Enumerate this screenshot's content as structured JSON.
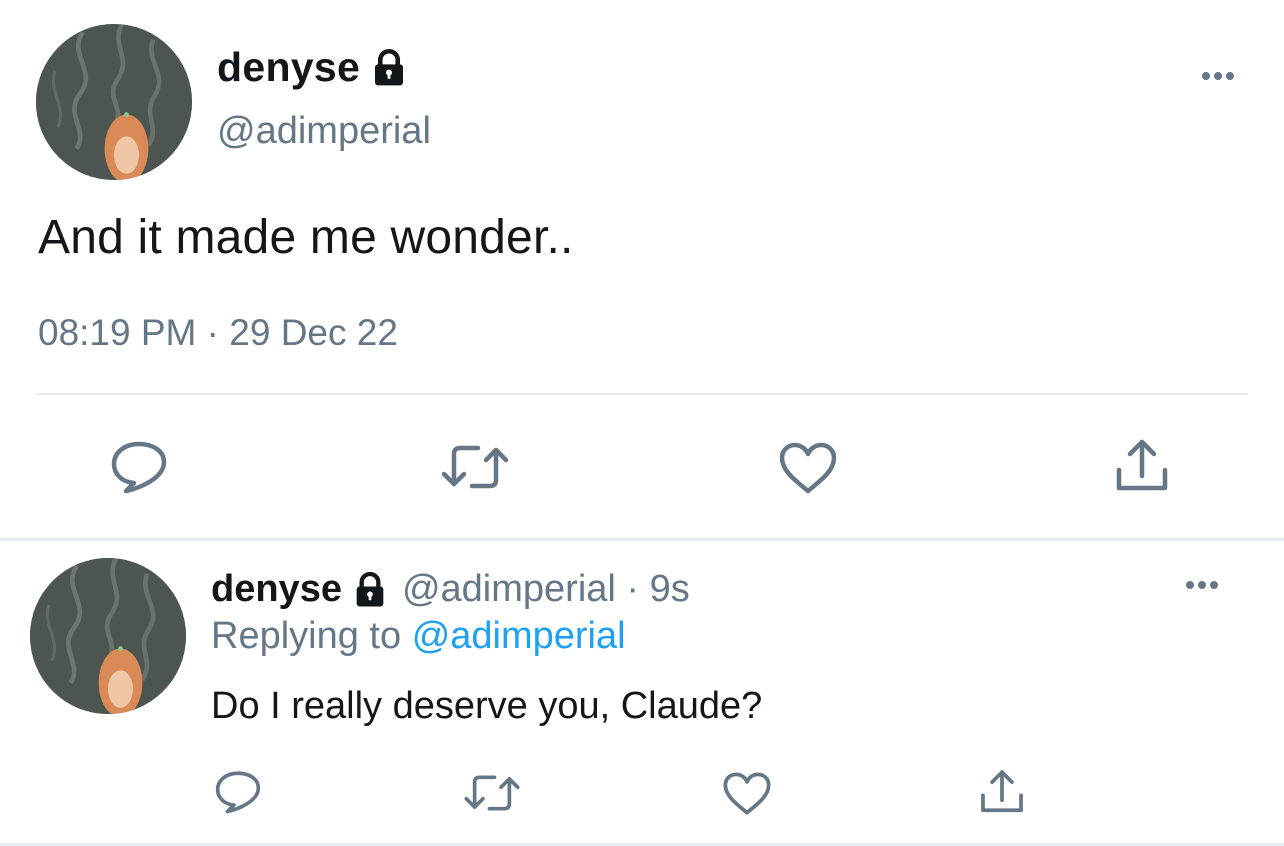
{
  "main_tweet": {
    "display_name": "denyse",
    "handle": "@adimperial",
    "text": "And it made me wonder..",
    "time": "08:19 PM",
    "separator": "·",
    "date": "29 Dec 22",
    "icons": {
      "protected": "lock-icon",
      "more": "more-options-icon",
      "reply": "reply-icon",
      "retweet": "retweet-icon",
      "like": "heart-icon",
      "share": "share-icon"
    }
  },
  "reply_tweet": {
    "display_name": "denyse",
    "handle_time": "@adimperial · 9s",
    "replying_prefix": "Replying to",
    "replying_to": "@adimperial",
    "text": "Do I really deserve you, Claude?"
  },
  "colors": {
    "text_primary": "#14171a",
    "text_secondary": "#657786",
    "mention": "#1da1f2",
    "divider": "#e6ecf0"
  }
}
